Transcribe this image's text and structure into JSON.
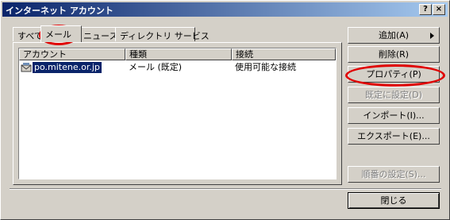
{
  "window": {
    "title": "インターネット アカウント",
    "help_label": "?",
    "close_label": "×"
  },
  "tabs": [
    {
      "label": "すべて"
    },
    {
      "label": "メール"
    },
    {
      "label": "ニュース"
    },
    {
      "label": "ディレクトリ サービス"
    }
  ],
  "list": {
    "headers": [
      "アカウント",
      "種類",
      "接続"
    ],
    "rows": [
      {
        "account": "po.mitene.or.jp",
        "type": "メール (既定)",
        "connection": "使用可能な接続"
      }
    ]
  },
  "buttons": {
    "add": "追加(A)",
    "remove": "削除(R)",
    "properties": "プロパティ(P)",
    "set_default": "既定に設定(D)",
    "import": "インポート(I)...",
    "export": "エクスポート(E)...",
    "set_order": "順番の設定(S)...",
    "close": "閉じる"
  },
  "colors": {
    "highlight": "#e00000",
    "selection": "#0a246a",
    "titlebar_start": "#0a246a",
    "titlebar_end": "#a6caf0",
    "face": "#d4d0c8"
  }
}
